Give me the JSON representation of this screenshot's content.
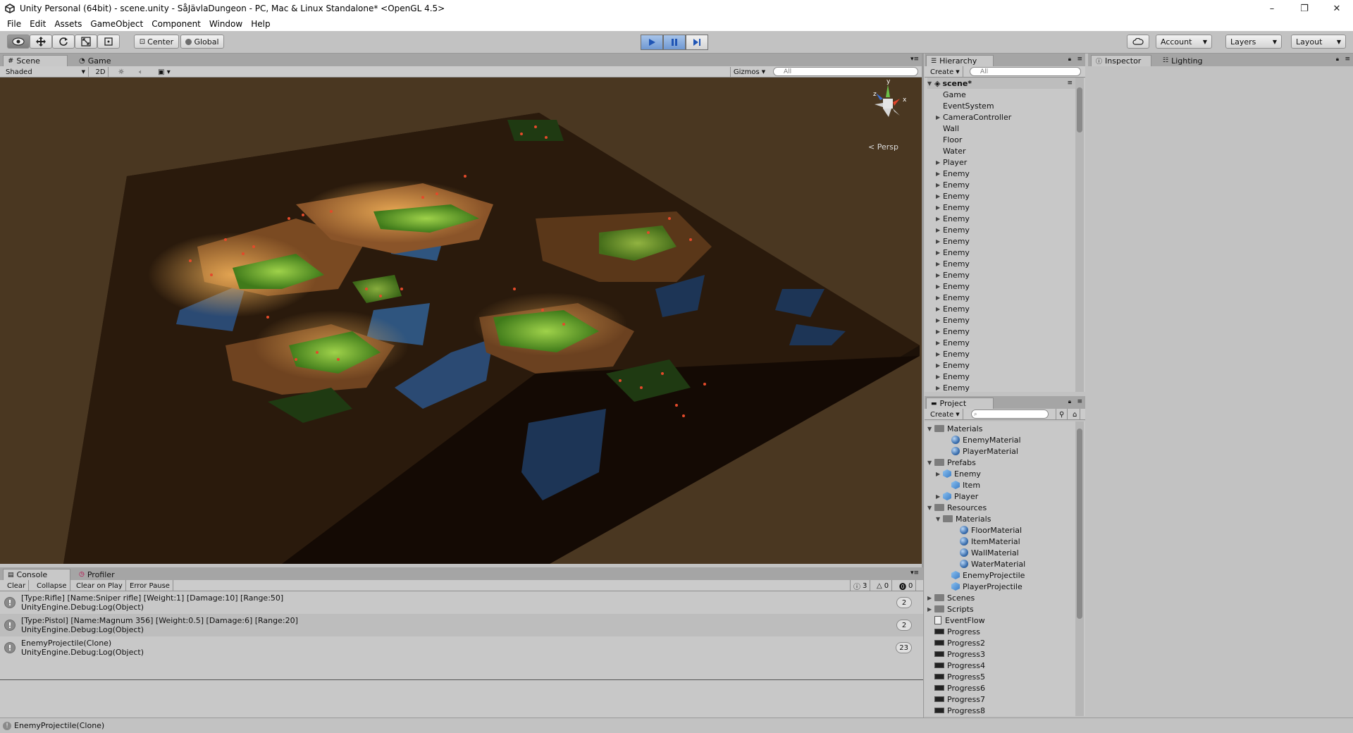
{
  "window": {
    "title": "Unity Personal (64bit) - scene.unity - SåJävlaDungeon - PC, Mac & Linux Standalone* <OpenGL 4.5>",
    "controls": [
      "–",
      "❐",
      "✕"
    ]
  },
  "menu": [
    "File",
    "Edit",
    "Assets",
    "GameObject",
    "Component",
    "Window",
    "Help"
  ],
  "toolbar": {
    "pivot": "Center",
    "space": "Global",
    "account": "Account",
    "layers": "Layers",
    "layout": "Layout"
  },
  "scene": {
    "tab_scene": "Scene",
    "tab_game": "Game",
    "shading": "Shaded",
    "mode_2d": "2D",
    "gizmos": "Gizmos",
    "search_placeholder": "All",
    "persp_label": "Persp",
    "gizmo_x": "x",
    "gizmo_y": "y",
    "gizmo_z": "z"
  },
  "console": {
    "tab_console": "Console",
    "tab_profiler": "Profiler",
    "buttons": [
      "Clear",
      "Collapse",
      "Clear on Play",
      "Error Pause"
    ],
    "counts": {
      "messages": "3",
      "warnings": "0",
      "errors": "0"
    },
    "logs": [
      {
        "line1": "[Type:Rifle] [Name:Sniper rifle] [Weight:1] [Damage:10] [Range:50]",
        "line2": "UnityEngine.Debug:Log(Object)",
        "count": "2"
      },
      {
        "line1": "[Type:Pistol] [Name:Magnum 356] [Weight:0.5] [Damage:6] [Range:20]",
        "line2": "UnityEngine.Debug:Log(Object)",
        "count": "2"
      },
      {
        "line1": "EnemyProjectile(Clone)",
        "line2": "UnityEngine.Debug:Log(Object)",
        "count": "23"
      }
    ],
    "status": "EnemyProjectile(Clone)"
  },
  "hierarchy": {
    "tab": "Hierarchy",
    "create": "Create",
    "search_placeholder": "All",
    "root": "scene*",
    "items": [
      "Game",
      "EventSystem",
      "CameraController",
      "Wall",
      "Floor",
      "Water",
      "Player",
      "Enemy",
      "Enemy",
      "Enemy",
      "Enemy",
      "Enemy",
      "Enemy",
      "Enemy",
      "Enemy",
      "Enemy",
      "Enemy",
      "Enemy",
      "Enemy",
      "Enemy",
      "Enemy",
      "Enemy",
      "Enemy",
      "Enemy",
      "Enemy",
      "Enemy",
      "Enemy"
    ]
  },
  "project": {
    "tab": "Project",
    "create": "Create",
    "items": [
      "Materials",
      "EnemyMaterial",
      "PlayerMaterial",
      "Prefabs",
      "Enemy",
      "Item",
      "Player",
      "Resources",
      "Materials",
      "FloorMaterial",
      "ItemMaterial",
      "WallMaterial",
      "WaterMaterial",
      "EnemyProjectile",
      "PlayerProjectile",
      "Scenes",
      "Scripts",
      "EventFlow",
      "Progress",
      "Progress2",
      "Progress3",
      "Progress4",
      "Progress5",
      "Progress6",
      "Progress7",
      "Progress8"
    ]
  },
  "inspector": {
    "tab": "Inspector",
    "tab_lighting": "Lighting"
  },
  "colors": {
    "editor_bg": "#c2c2c2",
    "scene_bg": "#4a3721",
    "play_blue": "#6f98d2"
  }
}
